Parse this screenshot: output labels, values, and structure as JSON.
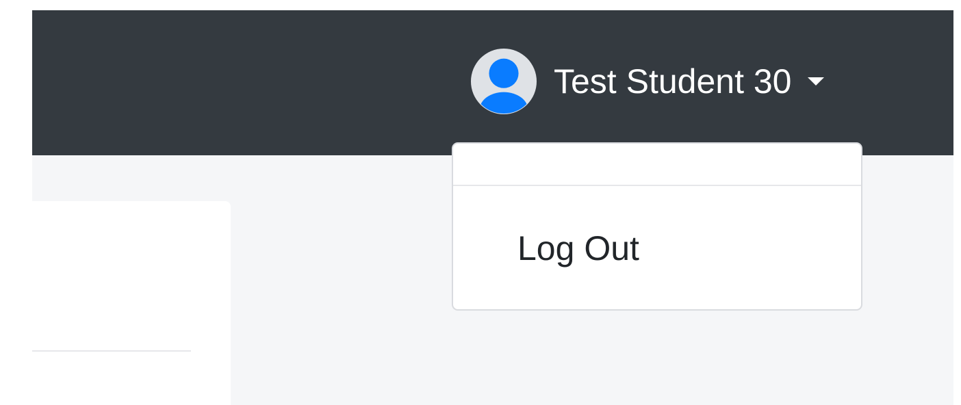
{
  "navbar": {
    "background_color": "#343a40",
    "user_menu": {
      "avatar_icon": "user-circle-icon",
      "avatar_color": "#0a7cff",
      "user_name": "Test Student 30",
      "caret_icon": "caret-down-icon"
    }
  },
  "dropdown": {
    "items": [
      {
        "label": "Log Out"
      }
    ]
  }
}
